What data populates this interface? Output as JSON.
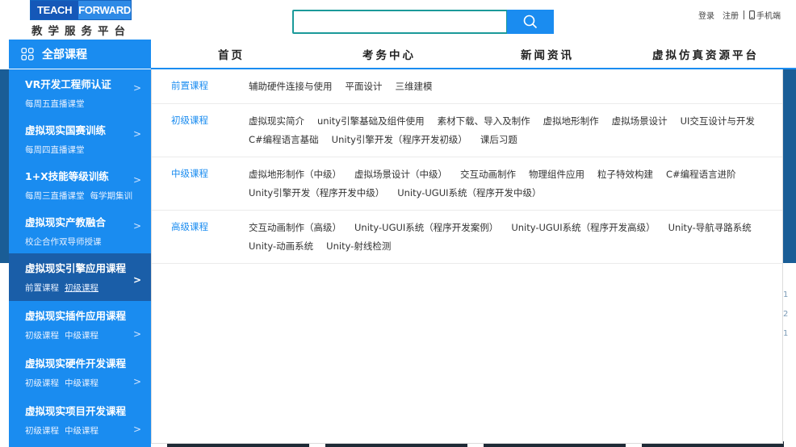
{
  "header": {
    "logo_teach": "TEACH",
    "logo_forward": "FORWARD",
    "logo_sub": "教学服务平台",
    "search_placeholder": "",
    "links": {
      "login": "登录",
      "register": "注册",
      "mobile": "手机端"
    }
  },
  "nav": {
    "all_courses": "全部课程",
    "items": [
      "首页",
      "考务中心",
      "新闻资讯",
      "虚拟仿真资源平台"
    ]
  },
  "sidebar": [
    {
      "title": "VR开发工程师认证",
      "subs": [
        "每周五直播课堂"
      ]
    },
    {
      "title": "虚拟现实国赛训练",
      "subs": [
        "每周四直播课堂"
      ]
    },
    {
      "title": "1+X技能等级训练",
      "subs": [
        "每周三直播课堂",
        "每学期集训"
      ]
    },
    {
      "title": "虚拟现实产教融合",
      "subs": [
        "校企合作双导师授课"
      ]
    },
    {
      "title": "虚拟现实引擎应用课程",
      "subs": [
        "前置课程",
        "初级课程"
      ]
    },
    {
      "title": "虚拟现实插件应用课程",
      "subs": [
        "初级课程",
        "中级课程"
      ]
    },
    {
      "title": "虚拟现实硬件开发课程",
      "subs": [
        "初级课程",
        "中级课程"
      ]
    },
    {
      "title": "虚拟现实项目开发课程",
      "subs": [
        "初级课程",
        "中级课程"
      ]
    }
  ],
  "panel": [
    {
      "level": "前置课程",
      "courses": [
        "辅助硬件连接与使用",
        "平面设计",
        "三维建模"
      ]
    },
    {
      "level": "初级课程",
      "courses": [
        "虚拟现实简介",
        "unity引擎基础及组件使用",
        "素材下载、导入及制作",
        "虚拟地形制作",
        "虚拟场景设计",
        "UI交互设计与开发",
        "C#编程语言基础",
        "Unity引擎开发（程序开发初级）",
        "课后习题"
      ]
    },
    {
      "level": "中级课程",
      "courses": [
        "虚拟地形制作（中级）",
        "虚拟场景设计（中级）",
        "交互动画制作",
        "物理组件应用",
        "粒子特效构建",
        "C#编程语言进阶",
        "Unity引擎开发（程序开发中级）",
        "Unity-UGUI系统（程序开发中级）"
      ]
    },
    {
      "level": "高级课程",
      "courses": [
        "交互动画制作（高级）",
        "Unity-UGUI系统（程序开发案例）",
        "Unity-UGUI系统（程序开发高级）",
        "Unity-导航寻路系统",
        "Unity-动画系统",
        "Unity-射线检测"
      ]
    }
  ],
  "edge_numbers": [
    "1",
    "2",
    "1"
  ],
  "colors": {
    "primary": "#1a8cf0",
    "dark_blue": "#1a5ea8",
    "search_border": "#1b9a9a"
  }
}
